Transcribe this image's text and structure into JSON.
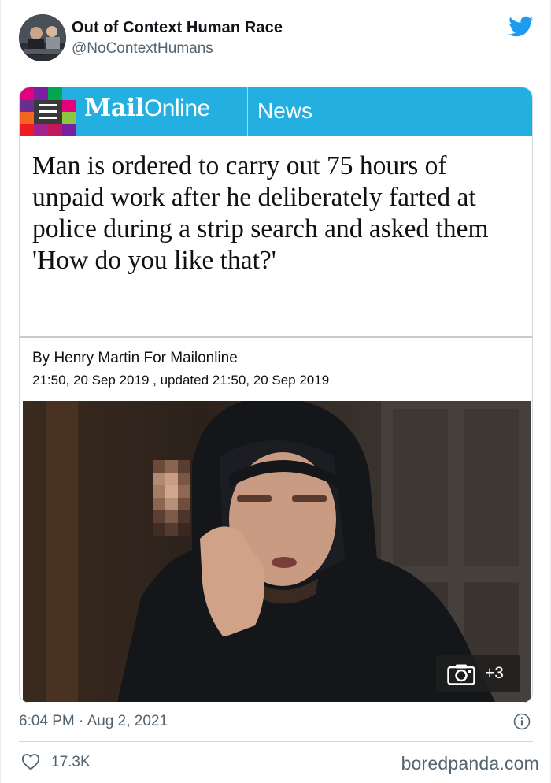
{
  "tweet": {
    "display_name": "Out of Context Human Race",
    "handle": "@NoContextHumans",
    "timestamp": "6:04 PM · Aug 2, 2021",
    "likes": "17.3K"
  },
  "article": {
    "brand_mail": "Mail",
    "brand_online": "Online",
    "section": "News",
    "headline": "Man is ordered to carry out 75 hours of unpaid work after he deliberately farted at police during a strip search and asked them 'How do you like that?'",
    "byline": "By Henry Martin For Mailonline",
    "dates": "21:50, 20 Sep 2019 , updated 21:50, 20 Sep 2019",
    "gallery_count": "+3"
  },
  "watermark": "boredpanda.com",
  "colors": {
    "mail_blue": "#23b0e1",
    "twitter_blue": "#1d9bf0",
    "muted_text": "#536471"
  }
}
